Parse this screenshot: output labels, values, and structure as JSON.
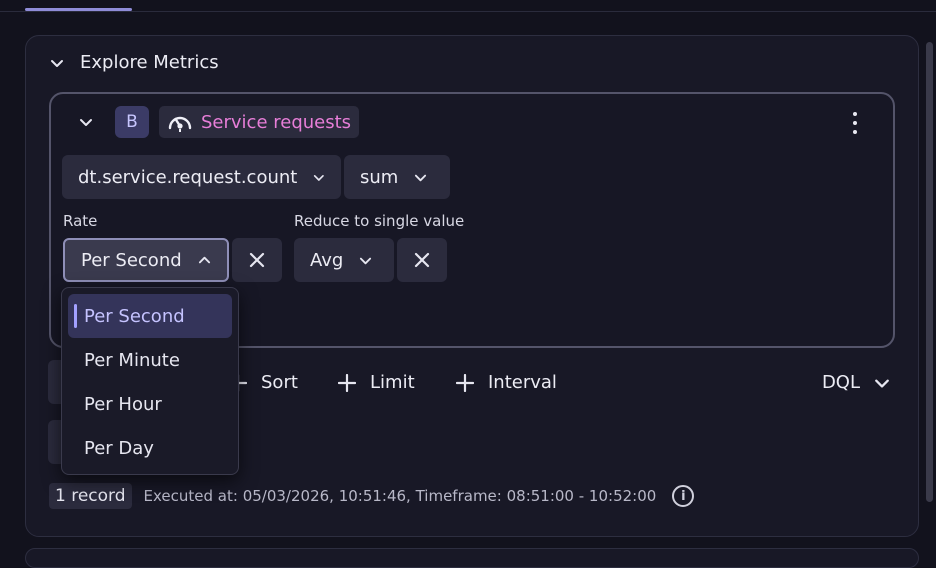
{
  "panel": {
    "title": "Explore Metrics"
  },
  "query": {
    "badge": "B",
    "service_name": "Service requests",
    "metric": "dt.service.request.count",
    "aggregation": "sum",
    "rate_label": "Rate",
    "rate_value": "Per Second",
    "reduce_label": "Reduce to single value",
    "reduce_value": "Avg"
  },
  "actions": {
    "sort": "Sort",
    "limit": "Limit",
    "interval": "Interval",
    "dql": "DQL"
  },
  "rate_options": [
    "Per Second",
    "Per Minute",
    "Per Hour",
    "Per Day"
  ],
  "footer": {
    "records": "1 record",
    "executed": "Executed at: 05/03/2026, 10:51:46, Timeframe: 08:51:00 - 10:52:00"
  },
  "colors": {
    "accent": "#8f8cd8",
    "service": "#e77ed8",
    "badge_bg": "#3b3b66"
  }
}
